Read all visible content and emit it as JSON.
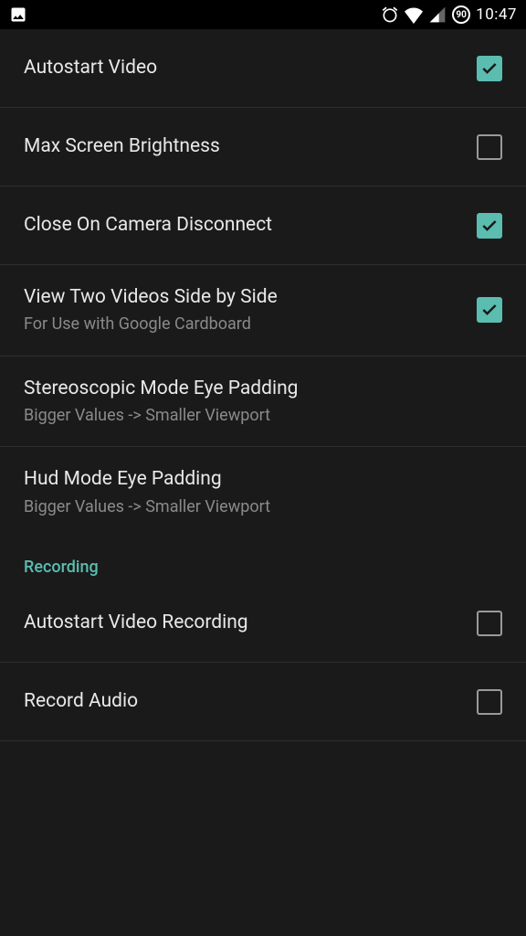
{
  "statusbar": {
    "time": "10:47",
    "badge": "90"
  },
  "settings": [
    {
      "title": "Autostart Video",
      "subtitle": null,
      "checked": true,
      "checkbox": true
    },
    {
      "title": "Max Screen Brightness",
      "subtitle": null,
      "checked": false,
      "checkbox": true
    },
    {
      "title": "Close On Camera Disconnect",
      "subtitle": null,
      "checked": true,
      "checkbox": true
    },
    {
      "title": "View Two Videos Side by Side",
      "subtitle": "For Use with Google Cardboard",
      "checked": true,
      "checkbox": true
    },
    {
      "title": "Stereoscopic Mode Eye Padding",
      "subtitle": "Bigger Values -> Smaller Viewport",
      "checked": null,
      "checkbox": false
    },
    {
      "title": "Hud Mode Eye Padding",
      "subtitle": "Bigger Values -> Smaller Viewport",
      "checked": null,
      "checkbox": false
    }
  ],
  "section": {
    "label": "Recording"
  },
  "recording": [
    {
      "title": "Autostart Video Recording",
      "subtitle": null,
      "checked": false,
      "checkbox": true
    },
    {
      "title": "Record Audio",
      "subtitle": null,
      "checked": false,
      "checkbox": true
    }
  ]
}
